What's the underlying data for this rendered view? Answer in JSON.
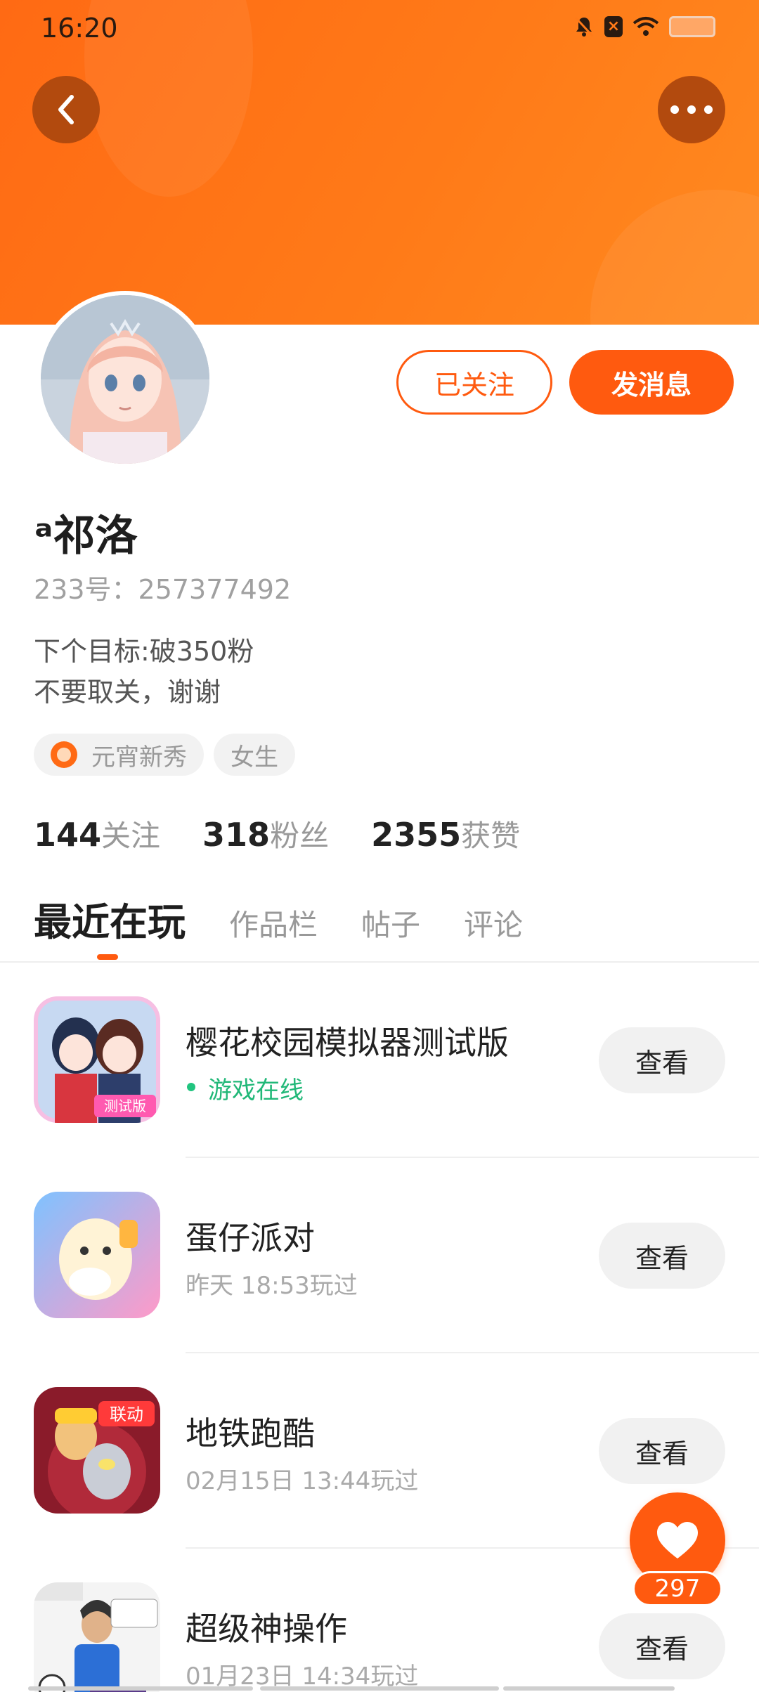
{
  "status_bar": {
    "time": "16:20",
    "icons": [
      "bell-off-icon",
      "close-box-icon",
      "wifi-icon",
      "battery-icon"
    ]
  },
  "header": {
    "back_icon": "chevron-left-icon",
    "more_icon": "more-dots-icon"
  },
  "profile": {
    "name": "ᵃ祁洛",
    "id_text": "233号：257377492",
    "bio_line1": "下个目标:破350粉",
    "bio_line2": "不要取关，谢谢",
    "tags": [
      "元宵新秀",
      "女生"
    ],
    "follow_label": "已关注",
    "message_label": "发消息"
  },
  "stats": [
    {
      "num": "144",
      "label": "关注"
    },
    {
      "num": "318",
      "label": "粉丝"
    },
    {
      "num": "2355",
      "label": "获赞"
    }
  ],
  "tabs": [
    {
      "label": "最近在玩",
      "active": true
    },
    {
      "label": "作品栏",
      "active": false
    },
    {
      "label": "帖子",
      "active": false
    },
    {
      "label": "评论",
      "active": false
    }
  ],
  "games": [
    {
      "title": "樱花校园模拟器测试版",
      "sub": "游戏在线",
      "online": true,
      "button": "查看"
    },
    {
      "title": "蛋仔派对",
      "sub": "昨天 18:53玩过",
      "online": false,
      "button": "查看"
    },
    {
      "title": "地铁跑酷",
      "sub": "02月15日 13:44玩过",
      "online": false,
      "button": "查看"
    },
    {
      "title": "超级神操作",
      "sub": "01月23日 14:34玩过",
      "online": false,
      "button": "查看"
    }
  ],
  "like_fab": {
    "count": "297",
    "icon": "heart-icon"
  },
  "colors": {
    "accent": "#ff5a0f",
    "banner": "#ff7a18",
    "online": "#21b878"
  }
}
